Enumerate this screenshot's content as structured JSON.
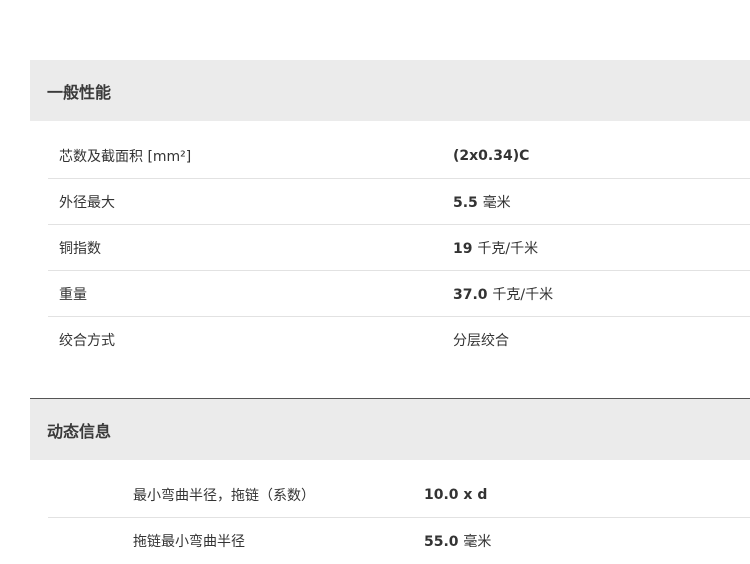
{
  "general": {
    "title": "一般性能",
    "rows": [
      {
        "label": "芯数及截面积 [mm²]",
        "value": "(2x0.34)C",
        "unit": ""
      },
      {
        "label": "外径最大",
        "value": "5.5",
        "unit": "毫米"
      },
      {
        "label": "铜指数",
        "value": "19",
        "unit": "千克/千米"
      },
      {
        "label": "重量",
        "value": "37.0",
        "unit": "千克/千米"
      },
      {
        "label": "绞合方式",
        "value": "",
        "unit": "分层绞合"
      }
    ]
  },
  "dynamic": {
    "title": "动态信息",
    "rows": [
      {
        "label": "最小弯曲半径，拖链（系数）",
        "value": "10.0 x d",
        "unit": ""
      },
      {
        "label": "拖链最小弯曲半径",
        "value": "55.0",
        "unit": "毫米"
      }
    ]
  }
}
